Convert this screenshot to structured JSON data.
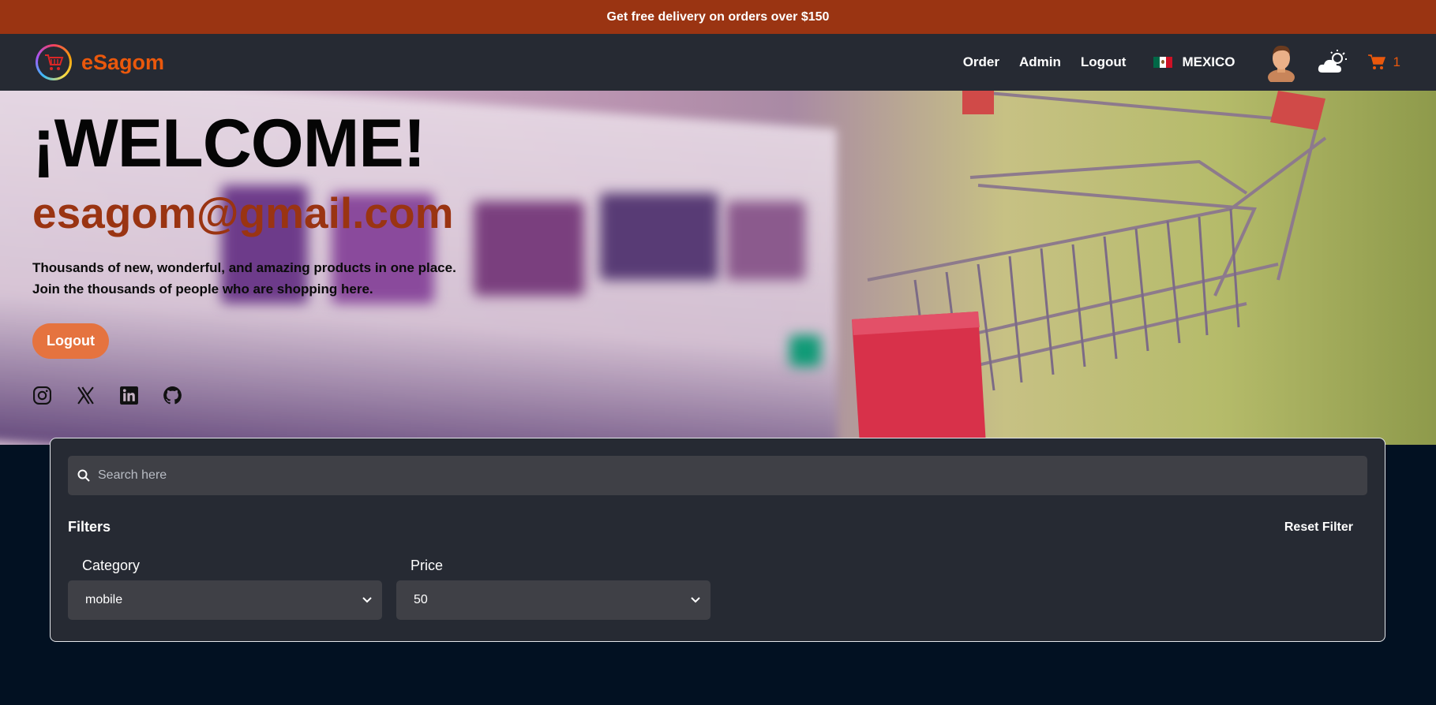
{
  "topbar": {
    "promo": "Get free delivery on orders over $150"
  },
  "navbar": {
    "brand": "eSagom",
    "links": [
      "Order",
      "Admin",
      "Logout"
    ],
    "country": "MEXICO",
    "cart_count": "1"
  },
  "hero": {
    "title": "¡WELCOME!",
    "email": "esagom@gmail.com",
    "line1": "Thousands of new, wonderful, and amazing products in one place.",
    "line2": "Join the thousands of people who are shopping here.",
    "button": "Logout"
  },
  "socials": [
    "instagram-icon",
    "x-icon",
    "linkedin-icon",
    "github-icon"
  ],
  "search": {
    "placeholder": "Search here"
  },
  "filters": {
    "label": "Filters",
    "reset": "Reset Filter",
    "category_label": "Category",
    "category_value": "mobile",
    "price_label": "Price",
    "price_value": "50"
  },
  "colors": {
    "accent": "#ea580c",
    "banner": "#9a3412",
    "nav_bg": "#262a33",
    "page_bg": "#021122",
    "button": "#e5733f"
  }
}
